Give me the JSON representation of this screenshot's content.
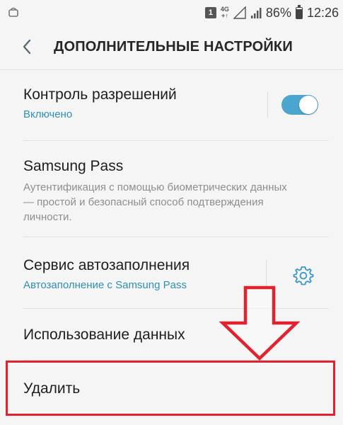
{
  "status_bar": {
    "sim_label": "1",
    "network": "4G",
    "network_sub": "+↑",
    "battery_percent": "86%",
    "battery_level": 0.86,
    "time": "12:26"
  },
  "header": {
    "title": "ДОПОЛНИТЕЛЬНЫЕ НАСТРОЙКИ"
  },
  "settings": {
    "permissions": {
      "title": "Контроль разрешений",
      "subtitle": "Включено",
      "enabled": true
    },
    "samsung_pass": {
      "title": "Samsung Pass",
      "description": "Аутентификация с помощью биометрических данных — простой и безопасный способ подтверждения личности."
    },
    "autofill": {
      "title": "Сервис автозаполнения",
      "subtitle": "Автозаполнение с Samsung Pass"
    },
    "data_usage": {
      "title": "Использование данных"
    },
    "delete": {
      "title": "Удалить"
    }
  },
  "colors": {
    "accent": "#2e8fb8",
    "toggle_on": "#4aa6cf",
    "highlight": "#e0232e"
  }
}
